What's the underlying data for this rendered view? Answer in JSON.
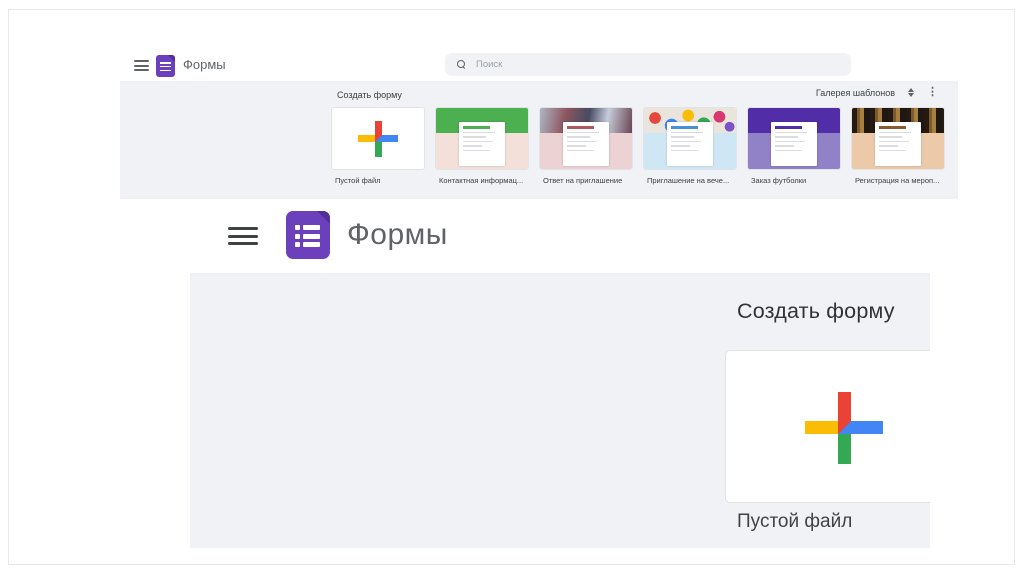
{
  "colors": {
    "purple": "#6c40bd",
    "purple_dark": "#51309a",
    "plus_top": "#ea4335",
    "plus_bottom": "#34a853",
    "plus_left": "#fbbc04",
    "plus_right": "#4285f4",
    "panel_bg": "#f0f2f5",
    "text_gray": "#5f6368",
    "text_dark": "#3c4043"
  },
  "icons": {
    "menu": "hamburger-menu",
    "search": "magnifier",
    "unfold": "unfold-more-arrows",
    "more": "vertical-three-dots"
  },
  "mini": {
    "header": {
      "app_title": "Формы",
      "search_placeholder": "Поиск"
    },
    "gallery": {
      "create_label": "Создать форму",
      "template_gallery_label": "Галерея шаблонов",
      "templates": [
        {
          "label": "Пустой файл",
          "kind": "blank"
        },
        {
          "label": "Контактная информац...",
          "kind": "solid",
          "header": "#4caf50",
          "body": "#f3e0d8",
          "accent": "#4caf50"
        },
        {
          "label": "Ответ на приглашение",
          "kind": "party",
          "body": "#ecd2d2",
          "accent": "#b3565e"
        },
        {
          "label": "Приглашение на вече...",
          "kind": "balloons",
          "body": "#cfe7f5",
          "accent": "#4a90d9"
        },
        {
          "label": "Заказ футболки",
          "kind": "solid",
          "header": "#512da8",
          "body": "#9181c6",
          "accent": "#512da8"
        },
        {
          "label": "Регистрация на мероп...",
          "kind": "books",
          "body": "#eccaa9",
          "accent": "#8a5a2a"
        }
      ]
    }
  },
  "zoomed": {
    "app_title": "Формы",
    "create_label": "Создать форму",
    "blank_label": "Пустой файл"
  }
}
